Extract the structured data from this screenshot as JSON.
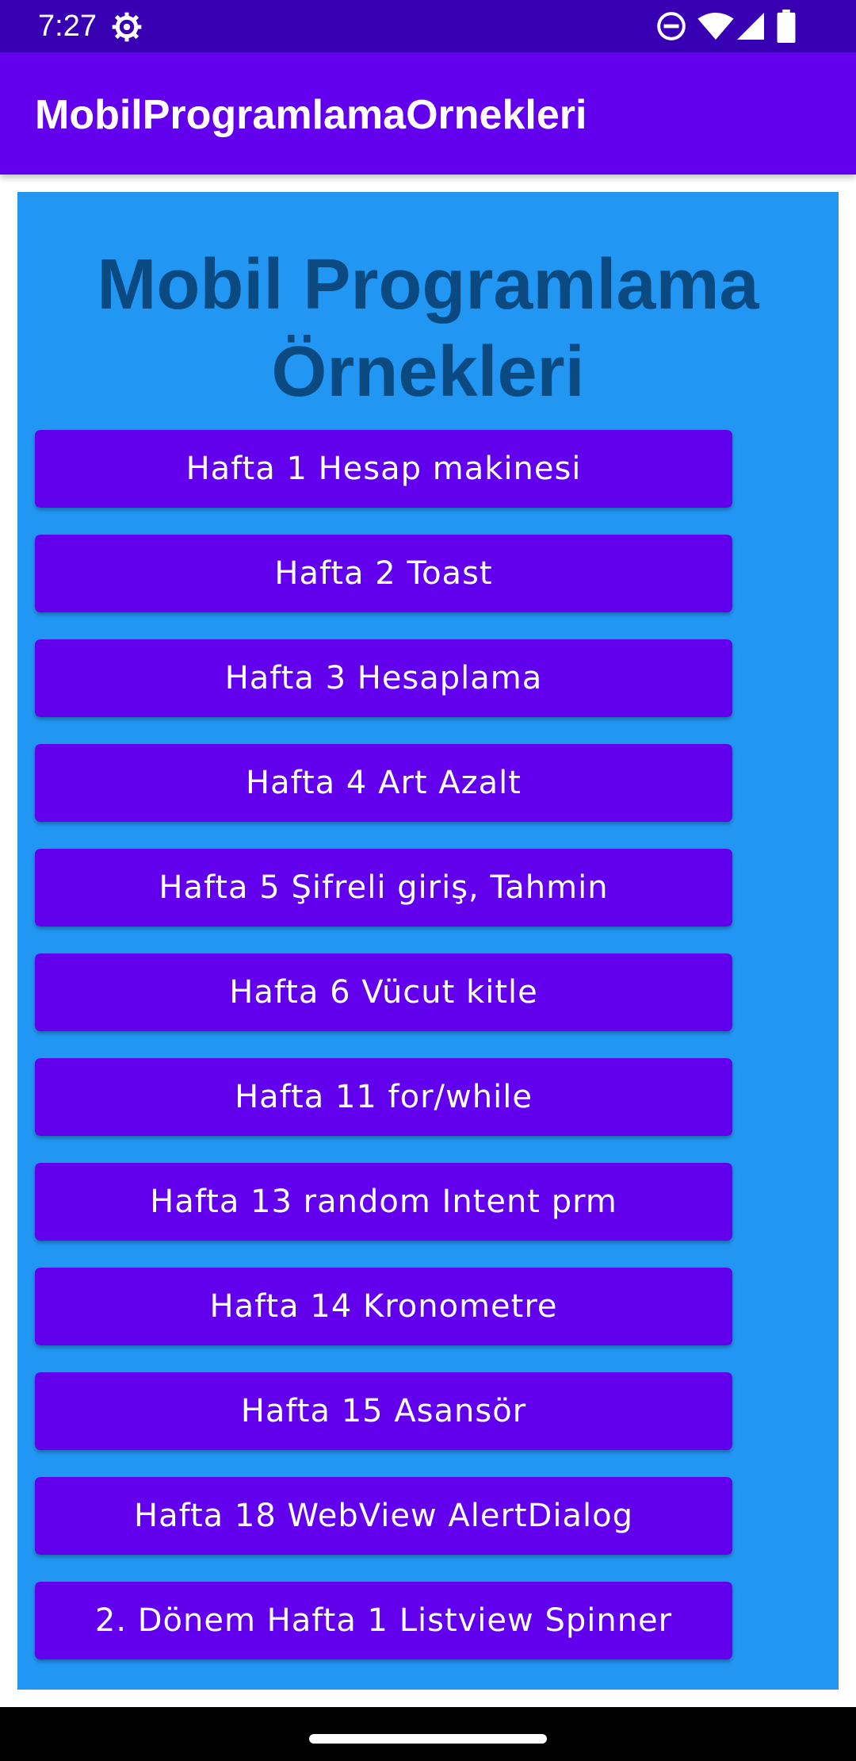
{
  "status_bar": {
    "time": "7:27",
    "icons": [
      "gear-icon",
      "do-not-disturb-icon",
      "wifi-icon",
      "signal-icon",
      "battery-icon"
    ]
  },
  "app_bar": {
    "title": "MobilProgramlamaOrnekleri"
  },
  "main": {
    "heading": "Mobil Programlama Örnekleri",
    "buttons": [
      {
        "label": "Hafta 1 Hesap makinesi"
      },
      {
        "label": "Hafta 2 Toast"
      },
      {
        "label": "Hafta 3 Hesaplama"
      },
      {
        "label": "Hafta 4 Art Azalt"
      },
      {
        "label": "Hafta 5 Şifreli giriş, Tahmin"
      },
      {
        "label": "Hafta 6 Vücut kitle"
      },
      {
        "label": "Hafta 11 for/while"
      },
      {
        "label": "Hafta 13 random Intent prm"
      },
      {
        "label": "Hafta 14 Kronometre"
      },
      {
        "label": "Hafta 15 Asansör"
      },
      {
        "label": "Hafta 18 WebView AlertDialog"
      },
      {
        "label": "2. Dönem Hafta 1 Listview Spinner"
      }
    ]
  },
  "colors": {
    "status_bar": "#3700B3",
    "app_bar": "#6200EE",
    "panel": "#2196F3",
    "heading": "#0B4A80",
    "button": "#6200EE"
  }
}
